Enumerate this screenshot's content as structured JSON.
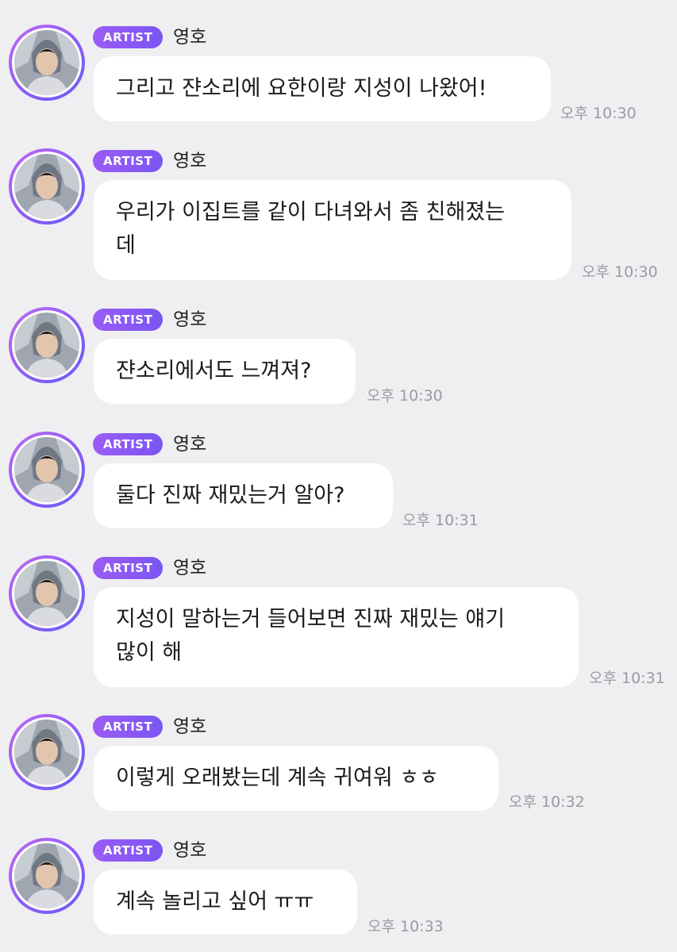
{
  "messages": [
    {
      "badge": "ARTIST",
      "sender": "영호",
      "lines": [
        "그리고 쟌소리에 요한이랑 지성이 나왔어!"
      ],
      "time": "오후 10:30"
    },
    {
      "badge": "ARTIST",
      "sender": "영호",
      "lines": [
        "우리가 이집트를 같이 다녀와서 좀 친해졌는",
        "데"
      ],
      "time": "오후 10:30"
    },
    {
      "badge": "ARTIST",
      "sender": "영호",
      "lines": [
        "쟌소리에서도 느껴져?"
      ],
      "time": "오후 10:30"
    },
    {
      "badge": "ARTIST",
      "sender": "영호",
      "lines": [
        "둘다 진짜 재밌는거 알아?"
      ],
      "time": "오후 10:31"
    },
    {
      "badge": "ARTIST",
      "sender": "영호",
      "lines": [
        "지성이 말하는거 들어보면 진짜 재밌는 얘기",
        "많이 해"
      ],
      "time": "오후 10:31"
    },
    {
      "badge": "ARTIST",
      "sender": "영호",
      "lines": [
        "이렇게 오래봤는데 계속 귀여워 ㅎㅎ"
      ],
      "time": "오후 10:32"
    },
    {
      "badge": "ARTIST",
      "sender": "영호",
      "lines": [
        "계속 놀리고 싶어 ㅠㅠ"
      ],
      "time": "오후 10:33"
    }
  ],
  "icons": {
    "avatar": "profile-photo-icon"
  },
  "colors": {
    "background": "#efeff1",
    "bubble": "#ffffff",
    "badge_start": "#9b5cf6",
    "badge_end": "#7a55f3",
    "time_text": "#9a9aa2"
  }
}
